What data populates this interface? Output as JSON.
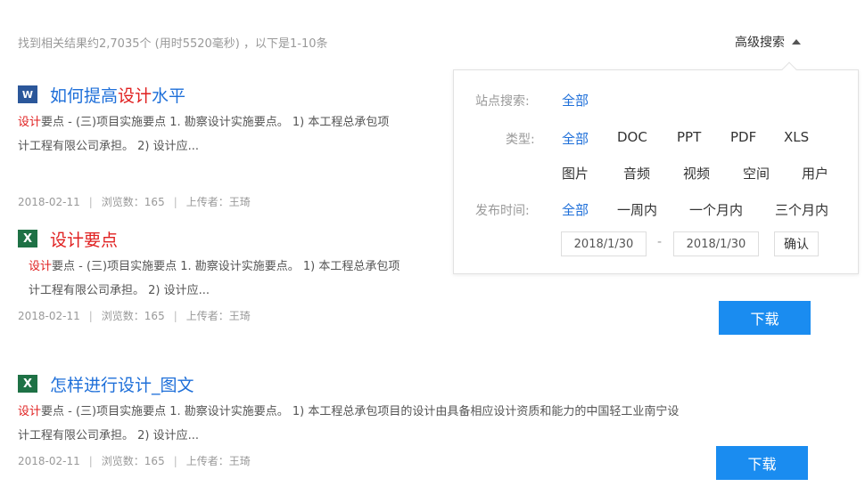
{
  "summary": "找到相关结果约2,7035个 (用时5520毫秒) ，以下是1-10条",
  "advanced_toggle": "高级搜索",
  "results": [
    {
      "icon": "W",
      "title_pre": "如何提高",
      "title_hl": "设计",
      "title_post": "水平",
      "snippet_hl": "设计",
      "snippet_line1": "要点 - (三)项目实施要点 1. 勘察设计实施要点。 1) 本工程总承包项",
      "snippet_line2": "计工程有限公司承担。 2) 设计应...",
      "date": "2018-02-11",
      "views": "浏览数：165",
      "uploader": "上传者：王琦"
    },
    {
      "icon": "X",
      "title_pre": "",
      "title_hl": "设计",
      "title_post": "要点",
      "snippet_hl": "设计",
      "snippet_line1": "要点 - (三)项目实施要点 1. 勘察设计实施要点。 1) 本工程总承包项",
      "snippet_line2": "计工程有限公司承担。 2) 设计应...",
      "date": "2018-02-11",
      "views": "浏览数：165",
      "uploader": "上传者：王琦",
      "download": "下载"
    },
    {
      "icon": "X",
      "title_pre": "怎样进行",
      "title_hl": "设计",
      "title_post": "_图文",
      "snippet_hl": "设计",
      "snippet_line1": "要点 - (三)项目实施要点 1. 勘察设计实施要点。 1) 本工程总承包项目的设计由具备相应设计资质和能力的中国轻工业南宁设",
      "snippet_line2": "计工程有限公司承担。 2) 设计应...",
      "date": "2018-02-11",
      "views": "浏览数：165",
      "uploader": "上传者：王琦",
      "download": "下载"
    }
  ],
  "meta_sep": "|",
  "adv": {
    "site_label": "站点搜索:",
    "site_all": "全部",
    "type_label": "类型:",
    "types_row1": [
      "全部",
      "DOC",
      "PPT",
      "PDF",
      "XLS"
    ],
    "types_row2": [
      "图片",
      "音频",
      "视频",
      "空间",
      "用户"
    ],
    "time_label": "发布时间:",
    "times": [
      "全部",
      "一周内",
      "一个月内",
      "三个月内"
    ],
    "date_from": "2018/1/30",
    "date_dash": "-",
    "date_to": "2018/1/30",
    "confirm": "确认"
  },
  "colors": {
    "link": "#1e6fd9",
    "highlight": "#e02020",
    "button": "#1a8cf0",
    "word": "#2b579a",
    "excel": "#1e7145"
  }
}
